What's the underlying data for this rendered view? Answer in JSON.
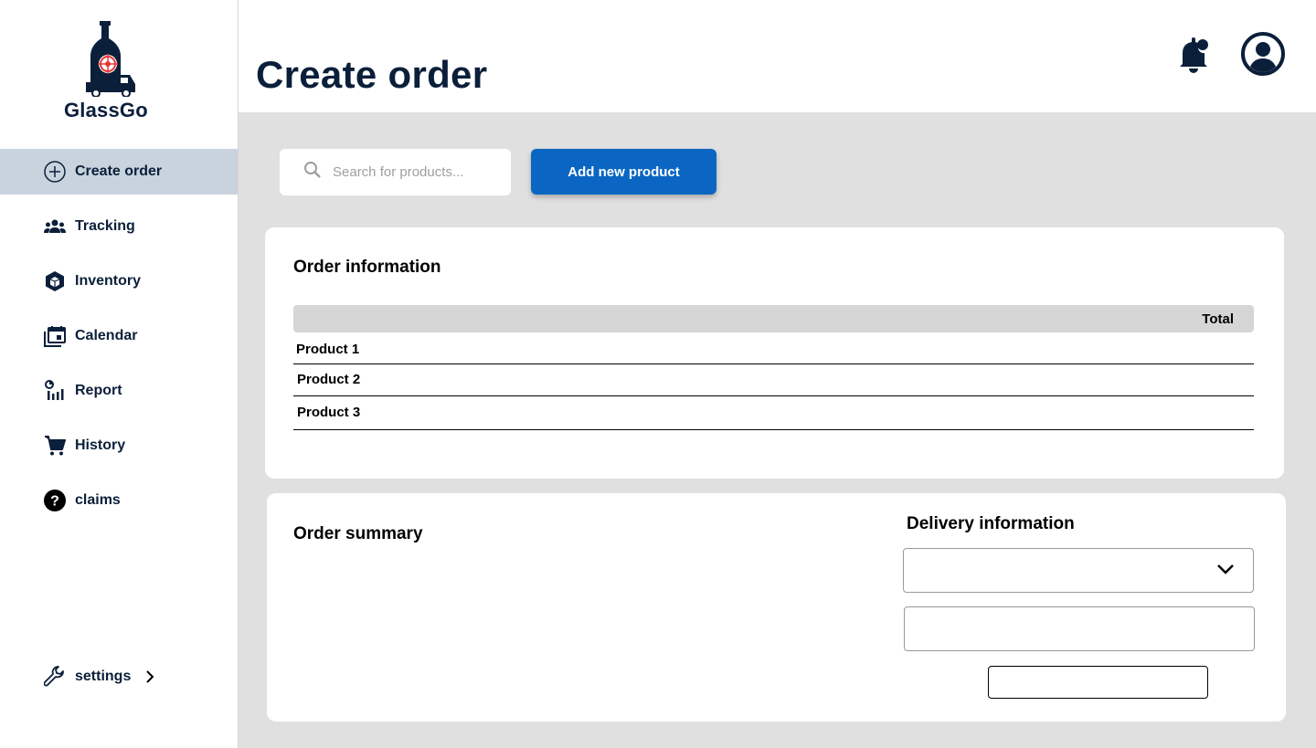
{
  "brand": {
    "name": "GlassGo"
  },
  "sidebar": {
    "items": [
      {
        "label": "Create order",
        "icon": "plus-circle-icon"
      },
      {
        "label": "Tracking",
        "icon": "people-icon"
      },
      {
        "label": "Inventory",
        "icon": "cube-icon"
      },
      {
        "label": "Calendar",
        "icon": "calendar-icon"
      },
      {
        "label": "Report",
        "icon": "report-icon"
      },
      {
        "label": "History",
        "icon": "cart-icon"
      },
      {
        "label": "claims",
        "icon": "help-icon"
      }
    ],
    "settings": {
      "label": "settings",
      "icon": "wrench-icon"
    }
  },
  "header": {
    "title": "Create order"
  },
  "toolbar": {
    "search_placeholder": "Search for products...",
    "add_button": "Add new product"
  },
  "order_info": {
    "title": "Order information",
    "column_total": "Total",
    "rows": [
      "Product 1",
      "Product 2",
      "Product 3"
    ]
  },
  "order_summary": {
    "title": "Order summary"
  },
  "delivery": {
    "title": "Delivery information"
  },
  "colors": {
    "primary": "#0a66c2",
    "navy": "#0b1f3a",
    "active_nav": "#c8d3de",
    "accent_red": "#e53935"
  }
}
